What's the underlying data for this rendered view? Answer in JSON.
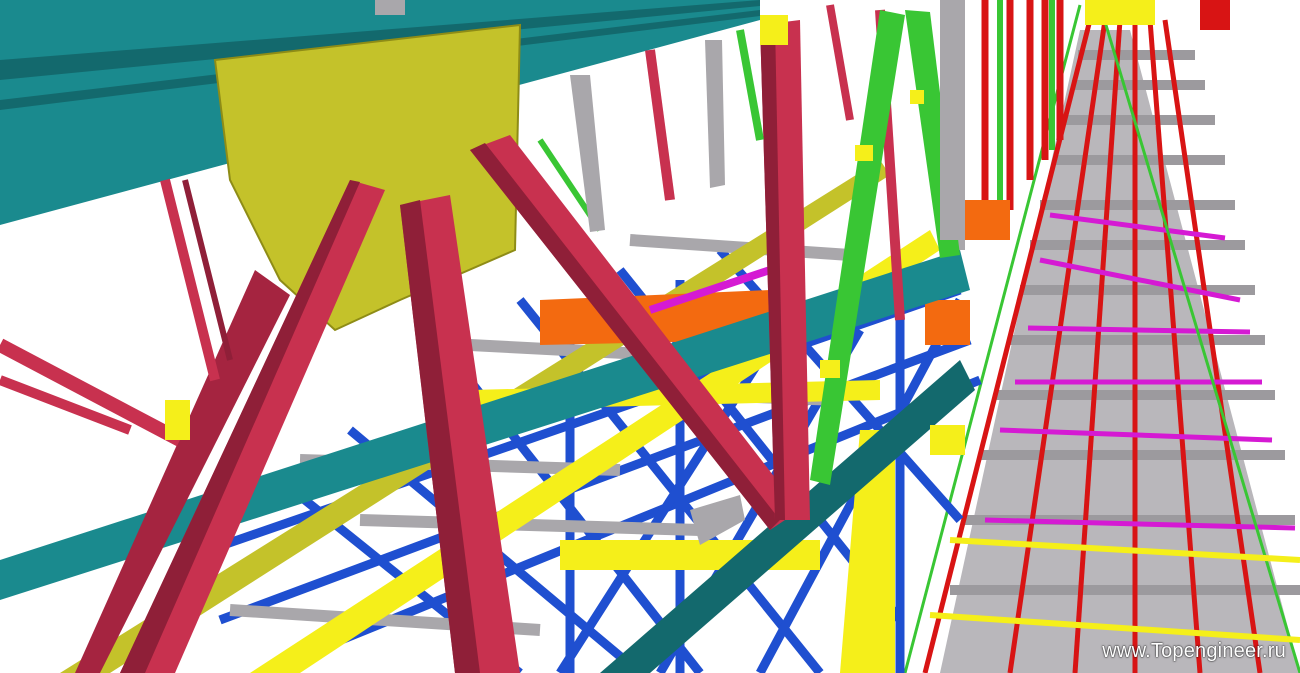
{
  "watermark": "www.Topengineer.ru",
  "colors": {
    "teal_beam": "#1a8a8e",
    "teal_dark": "#13696d",
    "yellow_plate": "#c4c22a",
    "yellow_bright": "#f5ef1a",
    "crimson": "#c8314f",
    "crimson_dark": "#8f1f38",
    "blue": "#1f4fd0",
    "green": "#39c634",
    "gray": "#a9a7ab",
    "red": "#d81414",
    "magenta": "#d51ad3",
    "orange": "#f36a10",
    "olive": "#a9a81b"
  }
}
